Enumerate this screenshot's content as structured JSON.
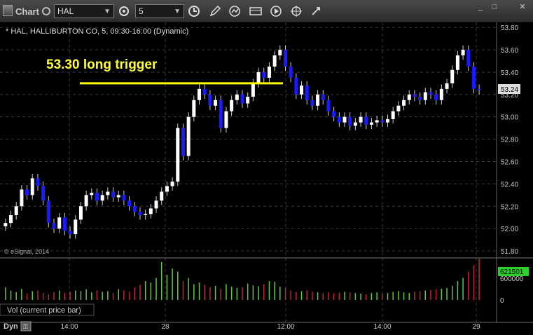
{
  "app": {
    "title": "Chart"
  },
  "toolbar": {
    "symbol": "HAL",
    "interval": "5"
  },
  "chart": {
    "caption": "* HAL, HALLIBURTON CO, 5, 09:30-16:00 (Dynamic)",
    "copyright": "© eSignal, 2014",
    "annotation": "53.30 long trigger",
    "last_price": "53.24",
    "colors": {
      "up": "#ffffff",
      "down": "#1a1aff",
      "trigger": "#ffff00",
      "vol_up": "#5ecb3c",
      "vol_down": "#c0282e",
      "last_badge": "#2bd02b"
    }
  },
  "volume": {
    "label": "Vol (current price bar)",
    "last": "621501",
    "ticks": [
      "600000",
      "0"
    ]
  },
  "footer": {
    "mode": "Dyn"
  },
  "chart_data": {
    "type": "candlestick",
    "title": "* HAL, HALLIBURTON CO, 5, 09:30-16:00 (Dynamic)",
    "y_ticks": [
      "53.80",
      "53.60",
      "53.40",
      "53.20",
      "53.00",
      "52.80",
      "52.60",
      "52.40",
      "52.20",
      "52.00",
      "51.80"
    ],
    "x_ticks": [
      "14:00",
      "28",
      "12:00",
      "14:00",
      "29"
    ],
    "ylim": [
      51.75,
      53.82
    ],
    "horizontal_line": 53.3,
    "close_path": [
      52.05,
      52.12,
      52.2,
      52.35,
      52.3,
      52.45,
      52.38,
      52.25,
      52.05,
      52.0,
      52.1,
      51.98,
      51.95,
      52.08,
      52.2,
      52.3,
      52.32,
      52.25,
      52.3,
      52.33,
      52.28,
      52.3,
      52.25,
      52.2,
      52.15,
      52.12,
      52.13,
      52.18,
      52.25,
      52.33,
      52.38,
      52.42,
      52.9,
      52.65,
      53.0,
      53.15,
      53.25,
      53.2,
      53.1,
      53.15,
      52.9,
      53.05,
      53.15,
      53.2,
      53.12,
      53.18,
      53.3,
      53.4,
      53.35,
      53.45,
      53.55,
      53.6,
      53.45,
      53.35,
      53.2,
      53.28,
      53.15,
      53.1,
      53.2,
      53.15,
      53.05,
      53.0,
      52.95,
      53.0,
      52.92,
      52.95,
      53.0,
      52.93,
      52.95,
      52.97,
      52.95,
      52.98,
      53.05,
      53.1,
      53.15,
      53.2,
      53.18,
      53.15,
      53.22,
      53.2,
      53.15,
      53.25,
      53.3,
      53.42,
      53.55,
      53.6,
      53.45,
      53.25,
      53.24
    ],
    "volume_path": [
      40,
      30,
      25,
      35,
      20,
      28,
      30,
      22,
      18,
      25,
      30,
      22,
      26,
      30,
      28,
      34,
      24,
      30,
      26,
      28,
      22,
      34,
      30,
      26,
      40,
      48,
      60,
      55,
      70,
      120,
      80,
      100,
      90,
      60,
      70,
      50,
      55,
      48,
      40,
      45,
      35,
      50,
      42,
      38,
      40,
      52,
      46,
      44,
      50,
      60,
      58,
      42,
      38,
      30,
      25,
      28,
      30,
      26,
      24,
      22,
      24,
      20,
      22,
      26,
      24,
      22,
      20,
      18,
      22,
      24,
      20,
      22,
      26,
      28,
      24,
      22,
      26,
      28,
      30,
      32,
      34,
      36,
      38,
      45,
      60,
      70,
      90,
      110,
      130
    ]
  }
}
